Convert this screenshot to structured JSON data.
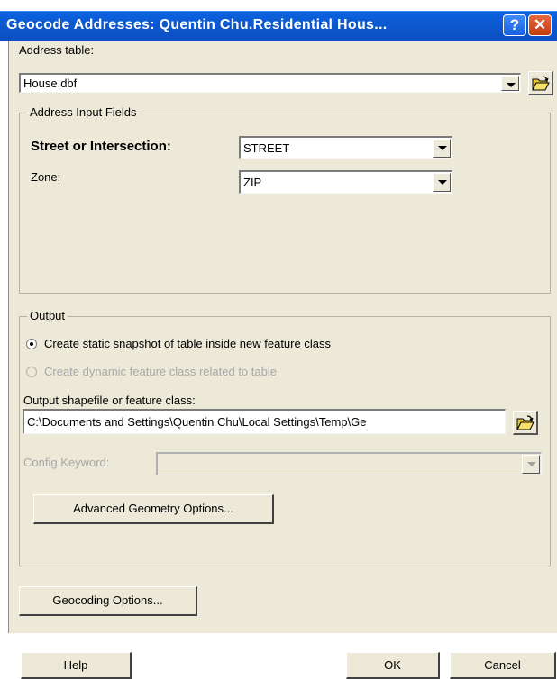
{
  "window": {
    "title": "Geocode Addresses:  Quentin Chu.Residential Hous...",
    "help_glyph": "?",
    "close_glyph": "✕"
  },
  "address_table": {
    "label": "Address table:",
    "value": "House.dbf"
  },
  "address_input_fields": {
    "group_title": "Address Input Fields",
    "street_label": "Street or Intersection:",
    "street_value": "STREET",
    "zone_label": "Zone:",
    "zone_value": "ZIP"
  },
  "output": {
    "group_title": "Output",
    "radio_static_label": "Create static snapshot of table inside new feature class",
    "radio_static_checked": true,
    "radio_dynamic_label": "Create dynamic feature class related to table",
    "radio_dynamic_enabled": false,
    "shapefile_label": "Output shapefile or feature class:",
    "shapefile_value": "C:\\Documents and Settings\\Quentin Chu\\Local Settings\\Temp\\Ge",
    "config_keyword_label": "Config Keyword:",
    "config_keyword_value": "",
    "advanced_button": "Advanced Geometry Options..."
  },
  "geocoding_options_button": "Geocoding Options...",
  "footer": {
    "help": "Help",
    "ok": "OK",
    "cancel": "Cancel"
  },
  "colors": {
    "titlebar": "#0d58cf",
    "dialog_bg": "#ece9d8",
    "close_button": "#c53a10"
  }
}
